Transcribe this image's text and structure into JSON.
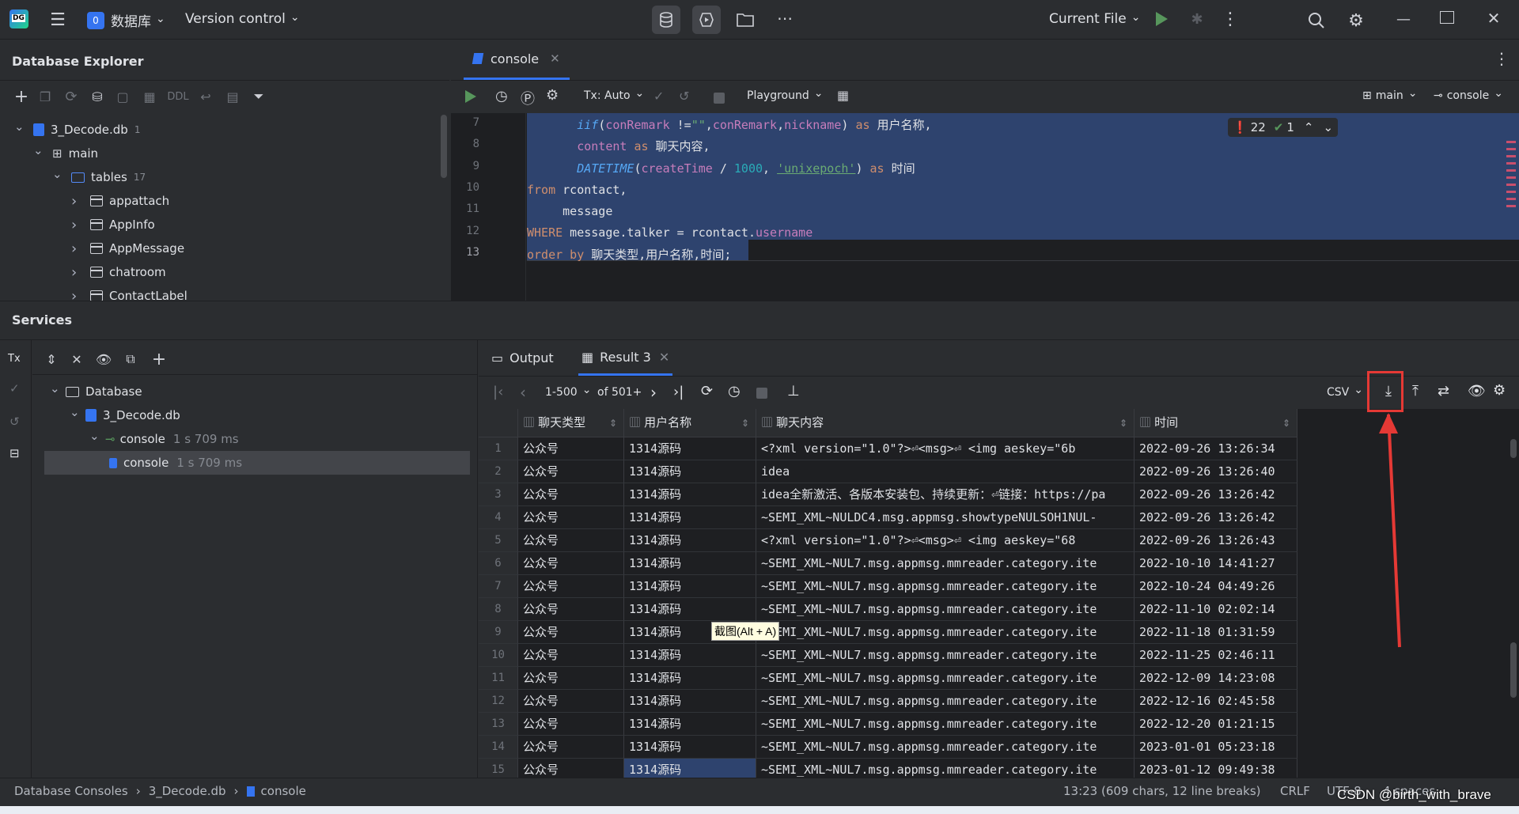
{
  "titlebar": {
    "project_badge": "0",
    "project_name": "数据库",
    "vcs": "Version control",
    "run_config": "Current File"
  },
  "explorer": {
    "title": "Database Explorer",
    "toolbar_ddl": "DDL",
    "tree": [
      {
        "label": "3_Decode.db",
        "badge": "1",
        "level": 0,
        "kind": "db",
        "expanded": true
      },
      {
        "label": "main",
        "badge": "",
        "level": 1,
        "kind": "schema",
        "expanded": true
      },
      {
        "label": "tables",
        "badge": "17",
        "level": 2,
        "kind": "folder",
        "expanded": true
      },
      {
        "label": "appattach",
        "badge": "",
        "level": 3,
        "kind": "table",
        "expanded": false
      },
      {
        "label": "AppInfo",
        "badge": "",
        "level": 3,
        "kind": "table",
        "expanded": false
      },
      {
        "label": "AppMessage",
        "badge": "",
        "level": 3,
        "kind": "table",
        "expanded": false
      },
      {
        "label": "chatroom",
        "badge": "",
        "level": 3,
        "kind": "table",
        "expanded": false
      },
      {
        "label": "ContactLabel",
        "badge": "",
        "level": 3,
        "kind": "table",
        "expanded": false
      }
    ]
  },
  "editor": {
    "tab": "console",
    "tx_mode": "Tx: Auto",
    "playground": "Playground",
    "schema": "main",
    "session": "console",
    "inspections": {
      "errors": "22",
      "ok": "1"
    },
    "lines": [
      {
        "n": "7"
      },
      {
        "n": "8"
      },
      {
        "n": "9"
      },
      {
        "n": "10"
      },
      {
        "n": "11"
      },
      {
        "n": "12"
      },
      {
        "n": "13"
      }
    ]
  },
  "services": {
    "title": "Services",
    "tx_label": "Tx",
    "tree": [
      {
        "label": "Database",
        "level": 0,
        "extra": ""
      },
      {
        "label": "3_Decode.db",
        "level": 1,
        "extra": ""
      },
      {
        "label": "console",
        "level": 2,
        "extra": "1 s 709 ms"
      },
      {
        "label": "console",
        "level": 3,
        "extra": "1 s 709 ms"
      }
    ]
  },
  "results": {
    "tabs": [
      "Output",
      "Result 3"
    ],
    "page_range": "1-500",
    "page_total": "of 501+",
    "export_format": "CSV",
    "columns": [
      "聊天类型",
      "用户名称",
      "聊天内容",
      "时间"
    ],
    "rows": [
      [
        "1",
        "公众号",
        "1314源码",
        "<?xml version=\"1.0\"?>⏎<msg>⏎    <img aeskey=\"6b",
        "2022-09-26 13:26:34"
      ],
      [
        "2",
        "公众号",
        "1314源码",
        "idea",
        "2022-09-26 13:26:40"
      ],
      [
        "3",
        "公众号",
        "1314源码",
        "idea全新激活、各版本安装包、持续更新：⏎链接：https://pa",
        "2022-09-26 13:26:42"
      ],
      [
        "4",
        "公众号",
        "1314源码",
        "~SEMI_XML~NULDC4.msg.appmsg.showtypeNULSOH1NUL-",
        "2022-09-26 13:26:42"
      ],
      [
        "5",
        "公众号",
        "1314源码",
        "<?xml version=\"1.0\"?>⏎<msg>⏎    <img aeskey=\"68",
        "2022-09-26 13:26:43"
      ],
      [
        "6",
        "公众号",
        "1314源码",
        "~SEMI_XML~NUL7.msg.appmsg.mmreader.category.ite",
        "2022-10-10 14:41:27"
      ],
      [
        "7",
        "公众号",
        "1314源码",
        "~SEMI_XML~NUL7.msg.appmsg.mmreader.category.ite",
        "2022-10-24 04:49:26"
      ],
      [
        "8",
        "公众号",
        "1314源码",
        "~SEMI_XML~NUL7.msg.appmsg.mmreader.category.ite",
        "2022-11-10 02:02:14"
      ],
      [
        "9",
        "公众号",
        "1314源码",
        "~SEMI_XML~NUL7.msg.appmsg.mmreader.category.ite",
        "2022-11-18 01:31:59"
      ],
      [
        "10",
        "公众号",
        "1314源码",
        "~SEMI_XML~NUL7.msg.appmsg.mmreader.category.ite",
        "2022-11-25 02:46:11"
      ],
      [
        "11",
        "公众号",
        "1314源码",
        "~SEMI_XML~NUL7.msg.appmsg.mmreader.category.ite",
        "2022-12-09 14:23:08"
      ],
      [
        "12",
        "公众号",
        "1314源码",
        "~SEMI_XML~NUL7.msg.appmsg.mmreader.category.ite",
        "2022-12-16 02:45:58"
      ],
      [
        "13",
        "公众号",
        "1314源码",
        "~SEMI_XML~NUL7.msg.appmsg.mmreader.category.ite",
        "2022-12-20 01:21:15"
      ],
      [
        "14",
        "公众号",
        "1314源码",
        "~SEMI_XML~NUL7.msg.appmsg.mmreader.category.ite",
        "2023-01-01 05:23:18"
      ],
      [
        "15",
        "公众号",
        "1314源码",
        "~SEMI_XML~NUL7.msg.appmsg.mmreader.category.ite",
        "2023-01-12 09:49:38"
      ]
    ],
    "tooltip": "截图(Alt + A)"
  },
  "statusbar": {
    "breadcrumb": [
      "Database Consoles",
      "3_Decode.db",
      "console"
    ],
    "position": "13:23 (609 chars, 12 line breaks)",
    "line_ending": "CRLF",
    "encoding": "UTF-8",
    "indent": "4 spaces",
    "watermark": "CSDN @birth_with_brave"
  },
  "colors": {
    "accent": "#3574f0",
    "highlight_box": "#e53935"
  }
}
